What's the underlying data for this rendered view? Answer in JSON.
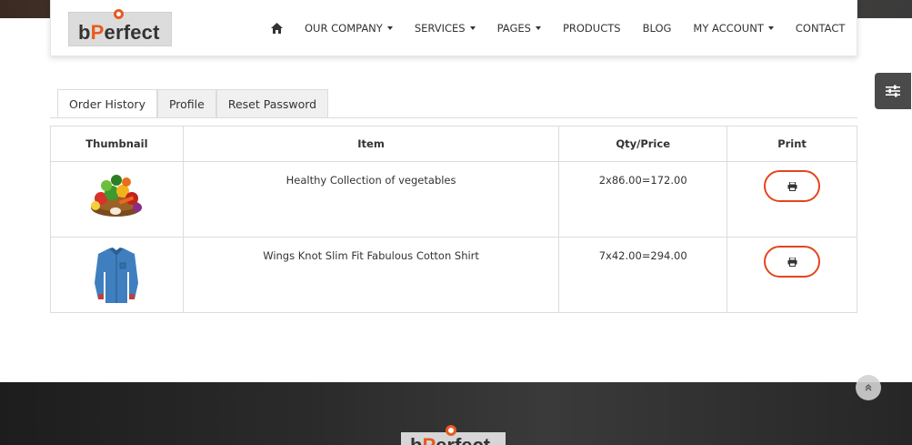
{
  "brand": {
    "logo_prefix": "b",
    "logo_accent": "P",
    "logo_suffix": "erfect",
    "accent_color": "#e85a1e"
  },
  "nav": {
    "home_icon": "home-icon",
    "items": [
      {
        "label": "OUR COMPANY",
        "dropdown": true
      },
      {
        "label": "SERVICES",
        "dropdown": true
      },
      {
        "label": "PAGES",
        "dropdown": true
      },
      {
        "label": "PRODUCTS",
        "dropdown": false
      },
      {
        "label": "BLOG",
        "dropdown": false
      },
      {
        "label": "MY ACCOUNT",
        "dropdown": true
      },
      {
        "label": "CONTACT",
        "dropdown": false
      }
    ]
  },
  "tabs": [
    {
      "label": "Order History",
      "active": true
    },
    {
      "label": "Profile",
      "active": false
    },
    {
      "label": "Reset Password",
      "active": false
    }
  ],
  "orders": {
    "headers": {
      "thumbnail": "Thumbnail",
      "item": "Item",
      "qty_price": "Qty/Price",
      "print": "Print"
    },
    "rows": [
      {
        "thumbnail_icon": "vegetables-image",
        "item": "Healthy Collection of vegetables",
        "qty_price": "2x86.00=172.00",
        "print_icon": "printer-icon"
      },
      {
        "thumbnail_icon": "shirt-image",
        "item": "Wings Knot Slim Fit Fabulous Cotton Shirt",
        "qty_price": "7x42.00=294.00",
        "print_icon": "printer-icon"
      }
    ]
  },
  "side_panel": {
    "icon": "sliders-icon"
  },
  "scroll_top": {
    "icon": "double-chevron-up-icon"
  }
}
